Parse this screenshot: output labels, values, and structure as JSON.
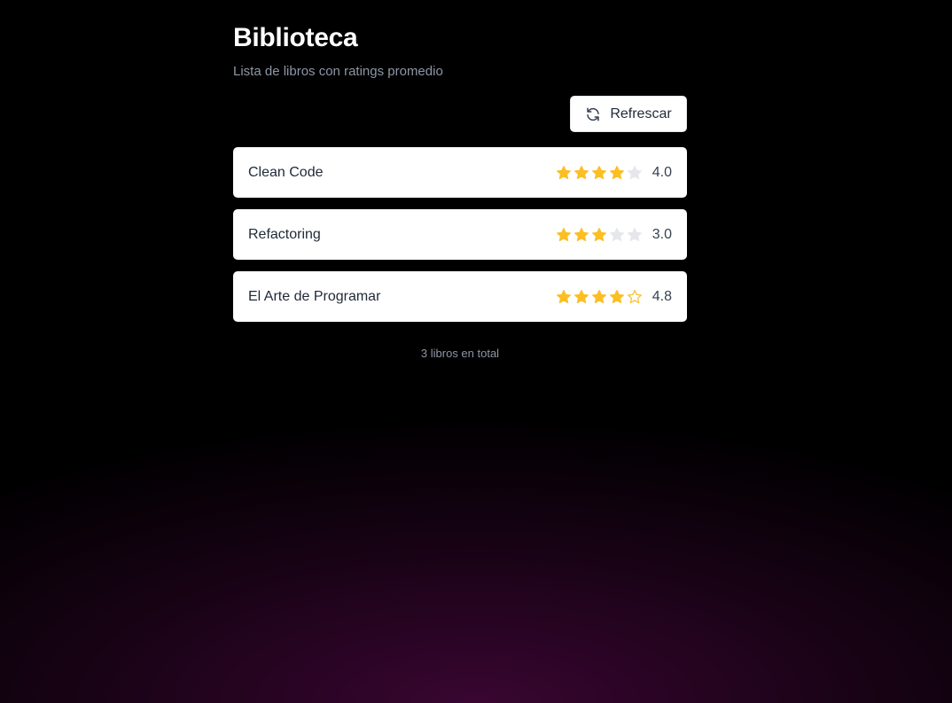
{
  "header": {
    "title": "Biblioteca",
    "subtitle": "Lista de libros con ratings promedio"
  },
  "toolbar": {
    "refresh_label": "Refrescar",
    "refresh_icon": "refresh-icon"
  },
  "books": [
    {
      "title": "Clean Code",
      "rating": "4.0",
      "stars": [
        "full",
        "full",
        "full",
        "full",
        "empty"
      ]
    },
    {
      "title": "Refactoring",
      "rating": "3.0",
      "stars": [
        "full",
        "full",
        "full",
        "empty",
        "empty"
      ]
    },
    {
      "title": "El Arte de Programar",
      "rating": "4.8",
      "stars": [
        "full",
        "full",
        "full",
        "full",
        "outline"
      ]
    }
  ],
  "footer": {
    "count_text": "3 libros en total"
  },
  "colors": {
    "star_filled": "#fbbf24",
    "star_empty": "#e5e7eb",
    "background": "#000000",
    "muted_text": "#8e96a6"
  }
}
